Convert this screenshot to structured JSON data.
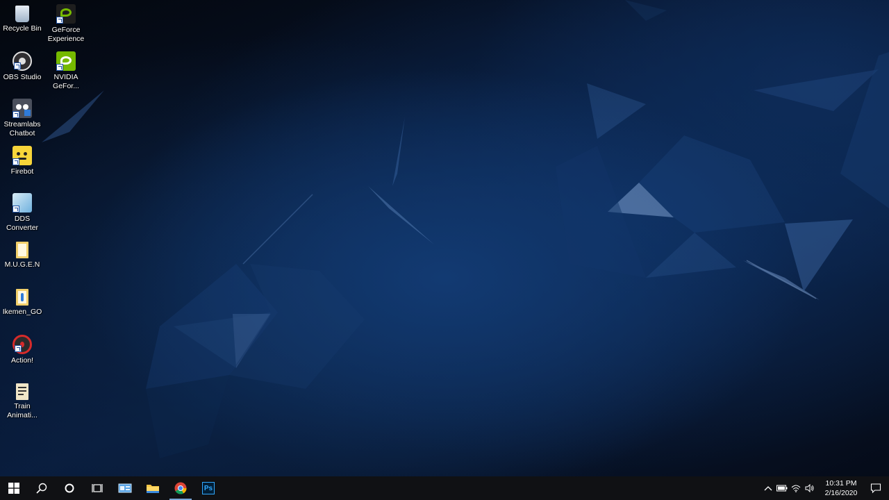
{
  "desktop": {
    "icons": [
      {
        "id": "recycle-bin",
        "label": "Recycle Bin"
      },
      {
        "id": "geforce-experience",
        "label": "GeForce\nExperience"
      },
      {
        "id": "obs-studio",
        "label": "OBS Studio"
      },
      {
        "id": "nvidia-geforce",
        "label": "NVIDIA\nGeFor..."
      },
      {
        "id": "streamlabs-chatbot",
        "label": "Streamlabs\nChatbot"
      },
      {
        "id": "firebot",
        "label": "Firebot"
      },
      {
        "id": "dds-converter",
        "label": "DDS\nConverter"
      },
      {
        "id": "mugen",
        "label": "M.U.G.E.N"
      },
      {
        "id": "ikemen-go",
        "label": "Ikemen_GO"
      },
      {
        "id": "action",
        "label": "Action!"
      },
      {
        "id": "train-animation",
        "label": "Train\nAnimati..."
      }
    ]
  },
  "taskbar": {
    "buttons": [
      {
        "id": "start",
        "icon": "windows-logo-icon"
      },
      {
        "id": "search",
        "icon": "search-icon"
      },
      {
        "id": "cortana",
        "icon": "cortana-circle-icon"
      },
      {
        "id": "task-view",
        "icon": "task-view-icon"
      },
      {
        "id": "app-1",
        "icon": "app-window-icon"
      },
      {
        "id": "file-explorer",
        "icon": "folder-icon"
      },
      {
        "id": "chrome",
        "icon": "chrome-icon"
      },
      {
        "id": "photoshop",
        "icon": "photoshop-icon",
        "text": "Ps"
      }
    ],
    "tray": {
      "icons": [
        "chevron-up-icon",
        "battery-icon",
        "wifi-icon",
        "volume-icon"
      ],
      "time": "10:31 PM",
      "date": "2/16/2020",
      "notification_icon": "notification-icon"
    }
  },
  "colors": {
    "taskbar_bg": "#101114",
    "wallpaper_accent": "#1f4f8f",
    "photoshop_blue": "#31a8ff",
    "nvidia_green": "#76b900"
  }
}
